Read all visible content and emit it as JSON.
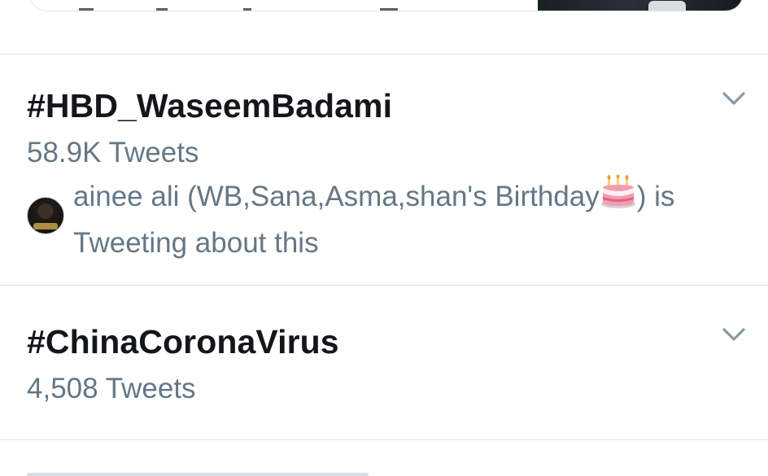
{
  "trends": [
    {
      "hashtag": "#HBD_WaseemBadami",
      "tweet_count": "58.9K Tweets",
      "context_before": "ainee ali (WB,Sana,Asma,shan's Birthday",
      "context_emoji": "🎂",
      "context_after": ") is Tweeting about this",
      "more_icon": "chevron-down-icon"
    },
    {
      "hashtag": "#ChinaCoronaVirus",
      "tweet_count": "4,508 Tweets",
      "more_icon": "chevron-down-icon"
    }
  ],
  "colors": {
    "primary_text": "#14171a",
    "secondary_text": "#657786",
    "divider": "#dde3e8",
    "chevron": "#8899a6"
  }
}
